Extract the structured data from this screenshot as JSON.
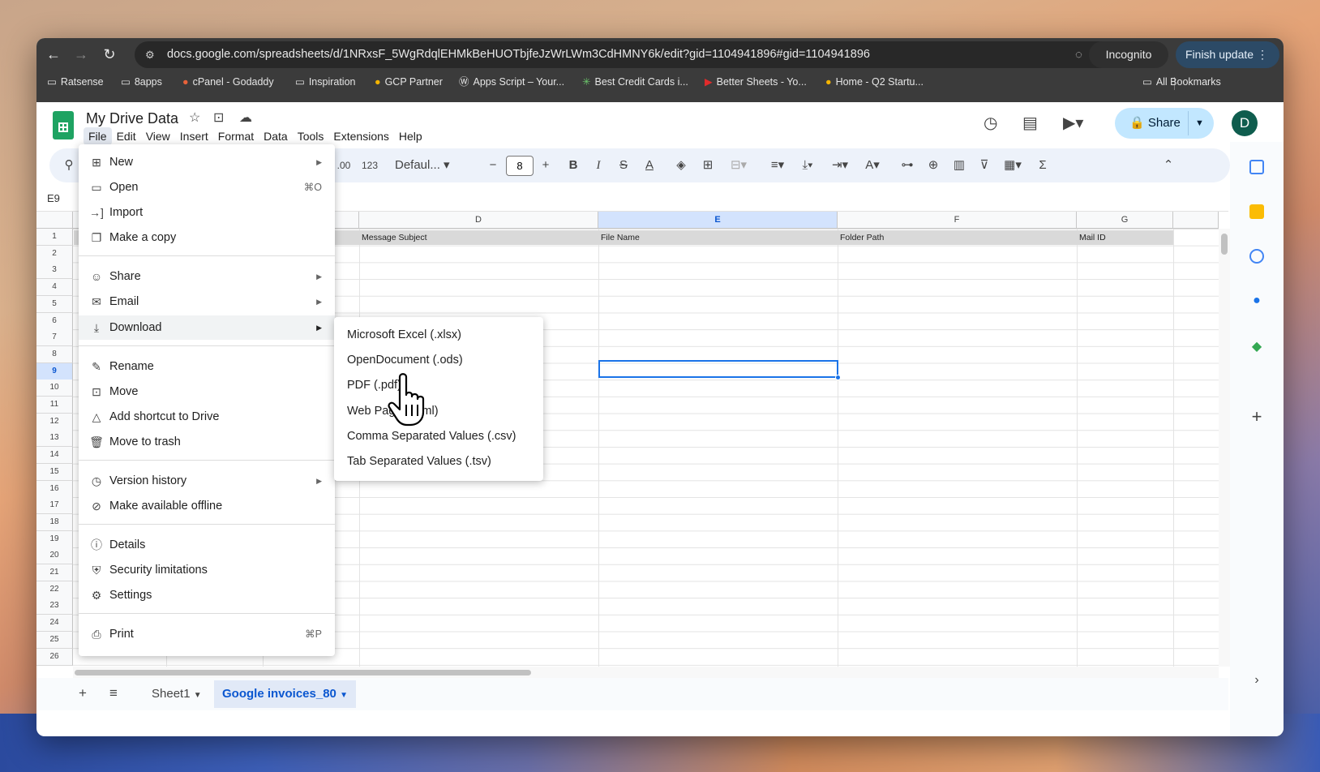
{
  "browser": {
    "url": "docs.google.com/spreadsheets/d/1NRxsF_5WgRdqlEHMkBeHUOTbjfeJzWrLWm3CdHMNY6k/edit?gid=1104941896#gid=1104941896",
    "incognito": "Incognito",
    "finish_update": "Finish update",
    "bookmarks": [
      "Ratsense",
      "8apps",
      "cPanel - Godaddy",
      "Inspiration",
      "GCP Partner",
      "Apps Script – Your...",
      "Best Credit Cards i...",
      "Better Sheets - Yo...",
      "Home - Q2 Startu..."
    ],
    "all_bookmarks": "All Bookmarks"
  },
  "doc": {
    "title": "My Drive Data",
    "menus": [
      "File",
      "Edit",
      "View",
      "Insert",
      "Format",
      "Data",
      "Tools",
      "Extensions",
      "Help"
    ],
    "share": "Share",
    "avatar": "D"
  },
  "toolbar": {
    "decimal": ".00",
    "num_format": "123",
    "font": "Defaul...",
    "font_size": "8"
  },
  "namebox": "E9",
  "columns": [
    "D",
    "E",
    "F",
    "G"
  ],
  "header_row": {
    "d": "Message Subject",
    "e": "File Name",
    "f": "Folder Path",
    "g": "Mail ID"
  },
  "rows": [
    "1",
    "2",
    "3",
    "4",
    "5",
    "6",
    "7",
    "8",
    "9",
    "10",
    "11",
    "12",
    "13",
    "14",
    "15",
    "16",
    "17",
    "18",
    "19",
    "20",
    "21",
    "22",
    "23",
    "24",
    "25",
    "26"
  ],
  "sheets": {
    "sheet1": "Sheet1",
    "active": "Google invoices_80"
  },
  "file_menu": {
    "new": "New",
    "open": "Open",
    "open_sc": "⌘O",
    "import": "Import",
    "copy": "Make a copy",
    "share": "Share",
    "email": "Email",
    "download": "Download",
    "rename": "Rename",
    "move": "Move",
    "shortcut": "Add shortcut to Drive",
    "trash": "Move to trash",
    "version": "Version history",
    "offline": "Make available offline",
    "details": "Details",
    "security": "Security limitations",
    "settings": "Settings",
    "print": "Print",
    "print_sc": "⌘P"
  },
  "download_menu": [
    "Microsoft Excel (.xlsx)",
    "OpenDocument (.ods)",
    "PDF (.pdf)",
    "Web Page (.html)",
    "Comma Separated Values (.csv)",
    "Tab Separated Values (.tsv)"
  ],
  "colors": {
    "accent": "#0b57d0",
    "share_bg": "#c2e7ff",
    "sheets_green": "#1ea362"
  }
}
